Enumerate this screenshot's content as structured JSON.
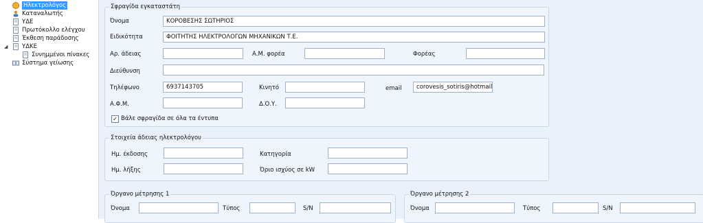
{
  "tree": {
    "items": [
      {
        "label": "Ηλεκτρολόγος",
        "icon": "electrician-icon",
        "selected": true
      },
      {
        "label": "Καταναλωτής",
        "icon": "person-icon"
      },
      {
        "label": "ΥΔΕ",
        "icon": "document-icon"
      },
      {
        "label": "Πρωτόκολλο ελέγχου",
        "icon": "document-icon"
      },
      {
        "label": "Έκθεση παράδοσης",
        "icon": "document-icon"
      },
      {
        "label": "ΥΔΚΕ",
        "icon": "document-icon"
      },
      {
        "label": "Συνημμένοι πίνακες",
        "icon": "document-icon"
      },
      {
        "label": "Σύστημα γείωσης",
        "icon": "grounding-icon"
      }
    ]
  },
  "installer_stamp": {
    "title": "Σφραγίδα εγκαταστάτη",
    "name_label": "Όνομα",
    "name_value": "ΚΟΡΟΒΕΣΗΣ ΣΩΤΗΡΙΟΣ",
    "specialty_label": "Ειδικότητα",
    "specialty_value": "ΦΟΙΤΗΤΗΣ ΗΛΕΚΤΡΟΛΟΓΩΝ ΜΗΧΑΝΙΚΩΝ Τ.Ε.",
    "license_label": "Αρ. άδειας",
    "license_value": "",
    "am_label": "Α.Μ. φορέα",
    "am_value": "",
    "body_label": "Φορέας",
    "body_value": "",
    "address_label": "Διεύθυνση",
    "address_value": "",
    "phone_label": "Τηλέφωνο",
    "phone_value": "6937143705",
    "mobile_label": "Κινητό",
    "mobile_value": "",
    "email_label": "email",
    "email_value": "corovesis_sotiris@hotmail.gr",
    "afm_label": "Α.Φ.Μ.",
    "afm_value": "",
    "doy_label": "Δ.Ο.Υ.",
    "doy_value": "",
    "stamp_checkbox_label": "Βάλε σφραγίδα σε όλα τα έντυπα",
    "stamp_checkbox_checked": true
  },
  "license_details": {
    "title": "Στοιχεία άδειας ηλεκτρολόγου",
    "issue_label": "Ημ. έκδοσης",
    "issue_value": "",
    "category_label": "Κατηγορία",
    "category_value": "",
    "expiry_label": "Ημ. λήξης",
    "expiry_value": "",
    "limit_label": "Όριο ισχύος σε kW",
    "limit_value": ""
  },
  "meter1": {
    "title": "Όργανο μέτρησης 1",
    "name_label": "Όνομα",
    "type_label": "Τύπος",
    "sn_label": "S/N"
  },
  "meter2": {
    "title": "Όργανο μέτρησης 2",
    "name_label": "Όνομα",
    "type_label": "Τύπος",
    "sn_label": "S/N"
  }
}
